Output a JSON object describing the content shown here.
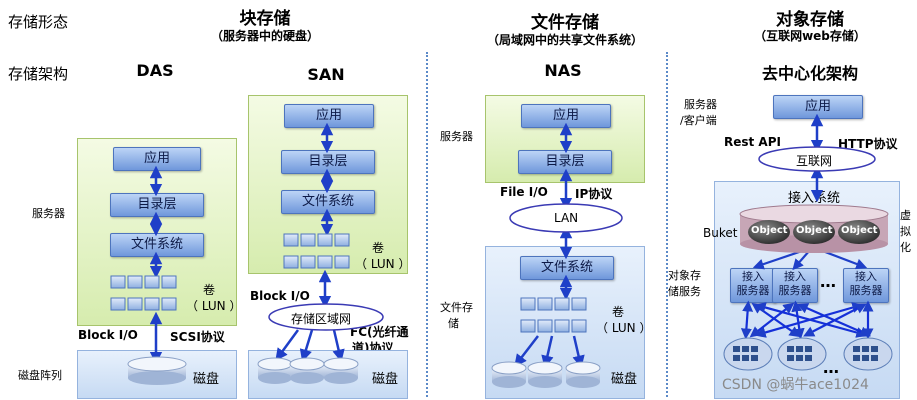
{
  "header": {
    "row_form_label": "存储形态",
    "row_arch_label": "存储架构",
    "block_title": "块存储",
    "block_sub": "（服务器中的硬盘）",
    "file_title": "文件存储",
    "file_sub": "（局域网中的共享文件系统）",
    "object_title": "对象存储",
    "object_sub": "（互联网web存储）"
  },
  "das": {
    "title": "DAS",
    "server_label": "服务器",
    "app": "应用",
    "dir": "目录层",
    "fs": "文件系统",
    "vol": "卷",
    "lun": "（ LUN ）",
    "block_io": "Block  I/O",
    "scsi": "SCSI协议",
    "array_label": "磁盘阵列",
    "disk": "磁盘"
  },
  "san": {
    "title": "SAN",
    "app": "应用",
    "dir": "目录层",
    "fs": "文件系统",
    "vol": "卷",
    "lun": "（ LUN ）",
    "block_io": "Block  I/O",
    "net": "存储区域网",
    "fc1": "FC(光纤通",
    "fc2": "道)协议",
    "disk": "磁盘"
  },
  "nas": {
    "title": "NAS",
    "server_label": "服务器",
    "app": "应用",
    "dir": "目录层",
    "file_io": "File  I/O",
    "ip": "IP协议",
    "lan": "LAN",
    "fs": "文件系统",
    "vol": "卷",
    "lun": "（ LUN ）",
    "storage_label1": "文件存",
    "storage_label2": "储",
    "disk": "磁盘"
  },
  "obj": {
    "title": "去中心化架构",
    "client1": "服务器",
    "client2": "/客户端",
    "app": "应用",
    "rest": "Rest API",
    "http": "HTTP协议",
    "internet": "互联网",
    "access": "接入系统",
    "bucket": "Buket",
    "object": "Object",
    "virt1": "虚",
    "virt2": "拟",
    "virt3": "化",
    "svc1": "对象存",
    "svc2": "储服务",
    "node1": "接入",
    "node2": "服务器",
    "dots": "…"
  },
  "watermark": "CSDN @蜗牛ace1024",
  "colors": {
    "server_fill": "#dcefb8",
    "storage_fill": "#cfe0f5",
    "layer_fill": "#7ea3df",
    "arrow": "#1f3fc8",
    "mesh_arrow": "#1530d8"
  }
}
